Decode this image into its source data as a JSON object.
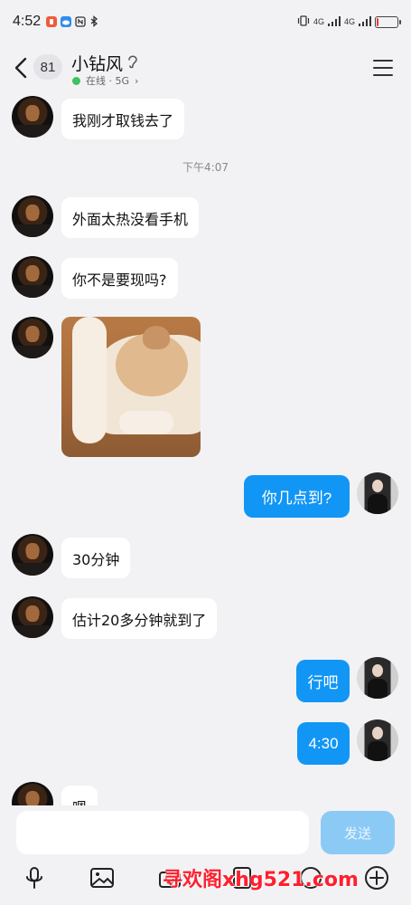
{
  "status_bar": {
    "time": "4:52",
    "network_1": "4G",
    "network_2": "4G"
  },
  "header": {
    "unread_count": "81",
    "contact_name": "小钻风",
    "status": "在线 · 5G",
    "status_arrow": "›"
  },
  "messages": [
    {
      "from": "them",
      "text": "我刚才取钱去了"
    },
    {
      "from": "system",
      "text": "下午4:07"
    },
    {
      "from": "them",
      "text": "外面太热没看手机"
    },
    {
      "from": "them",
      "text": "你不是要现吗?"
    },
    {
      "from": "them",
      "type": "image",
      "image": "shiba-dog-photo"
    },
    {
      "from": "me",
      "text": "你几点到?"
    },
    {
      "from": "them",
      "text": "30分钟"
    },
    {
      "from": "them",
      "text": "估计20多分钟就到了"
    },
    {
      "from": "me",
      "text": "行吧"
    },
    {
      "from": "me",
      "text": "4:30"
    },
    {
      "from": "them",
      "text": "嗯"
    }
  ],
  "input": {
    "placeholder": "",
    "send_label": "发送"
  },
  "watermark": "寻欢阁xhg521.com",
  "colors": {
    "outgoing_bubble": "#1296f5",
    "send_button_disabled": "#8ccaf6",
    "online_dot": "#3dc35f",
    "battery_low": "#e53935",
    "watermark": "#ff1f2f"
  },
  "battery_level": 0.1
}
